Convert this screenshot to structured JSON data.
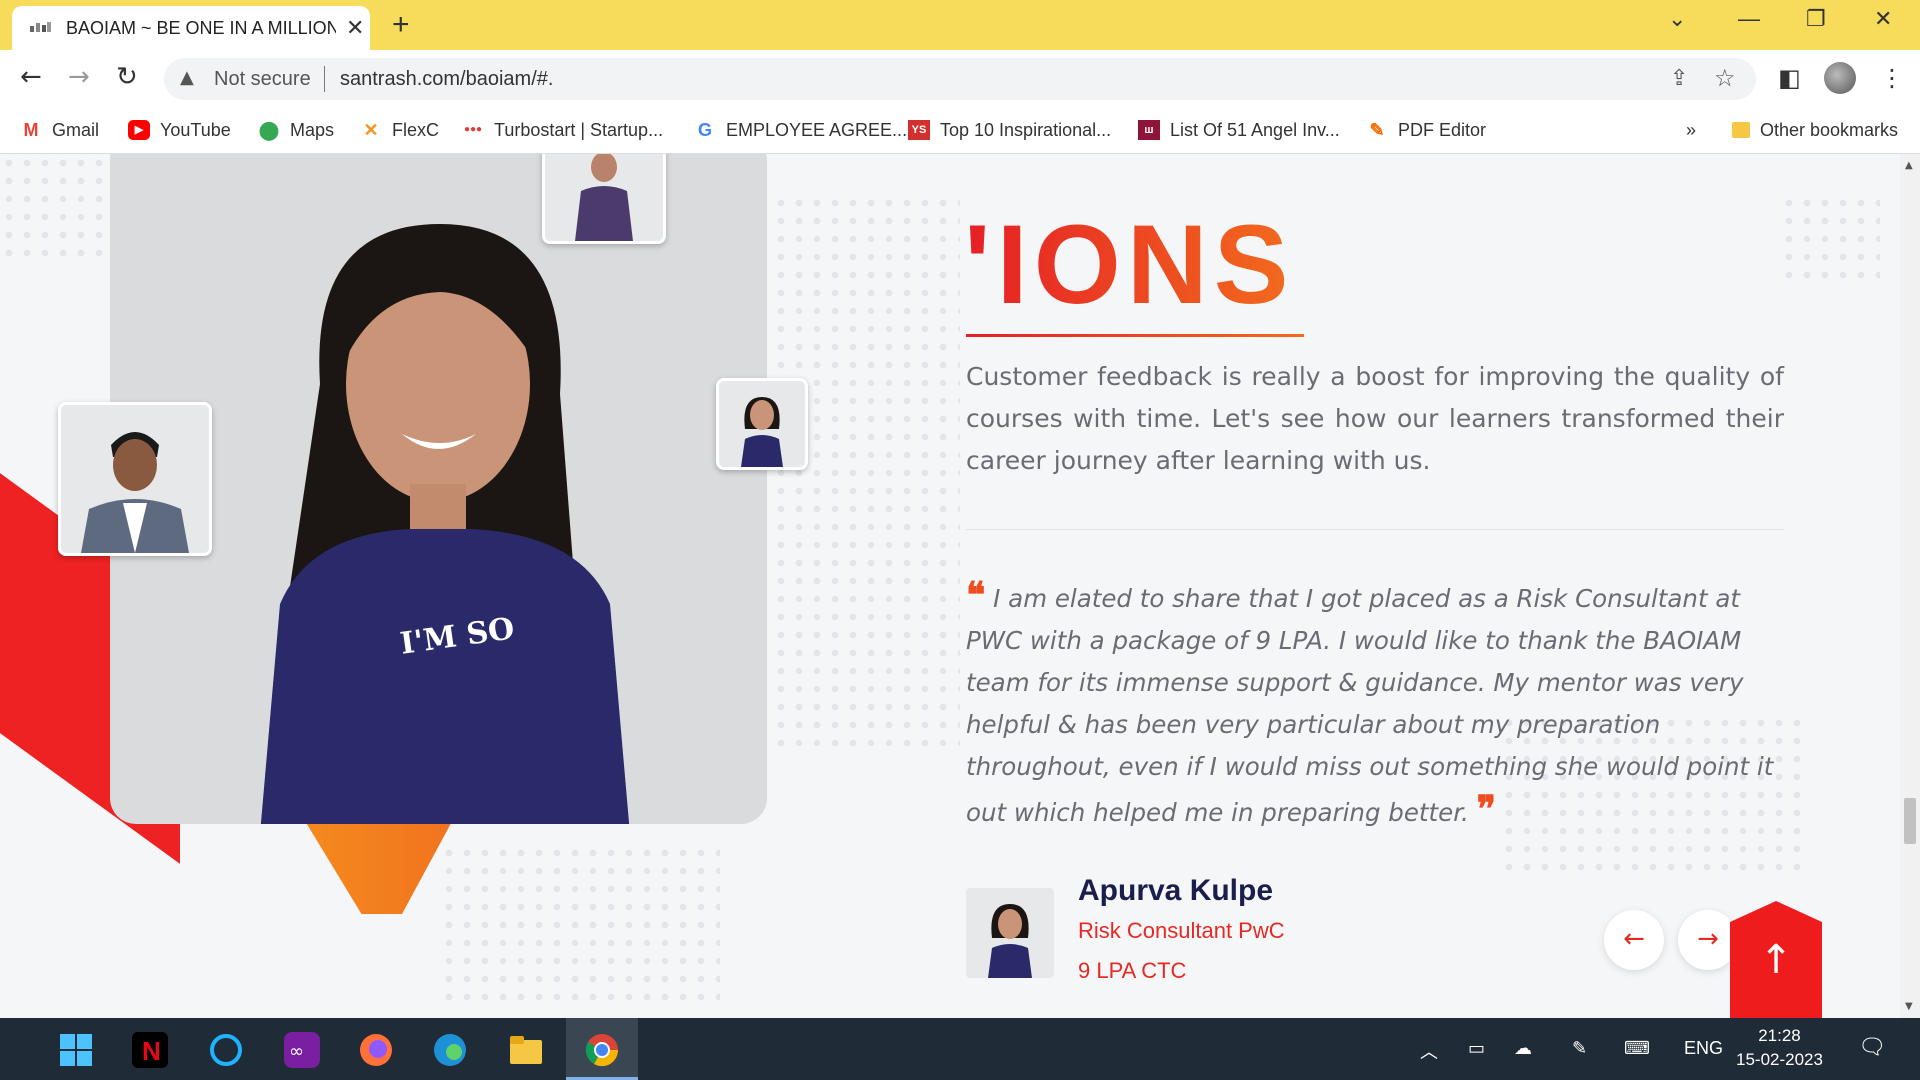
{
  "browser": {
    "tab_title": "BAOIAM ~ BE ONE IN A MILLION",
    "tab_close": "✕",
    "new_tab": "+",
    "security_label": "Not secure",
    "url": "santrash.com/baoiam/#."
  },
  "bookmarks": [
    {
      "label": "Gmail",
      "icon": "gmail-icon",
      "color": "#ea4335"
    },
    {
      "label": "YouTube",
      "icon": "youtube-icon",
      "color": "#ff0000"
    },
    {
      "label": "Maps",
      "icon": "maps-icon",
      "color": "#34a853"
    },
    {
      "label": "FlexC",
      "icon": "flexc-icon",
      "color": "#f7931e"
    },
    {
      "label": "Turbostart | Startup...",
      "icon": "turbostart-icon",
      "color": "#e53935"
    },
    {
      "label": "EMPLOYEE AGREE...",
      "icon": "google-icon",
      "color": "#4285f4"
    },
    {
      "label": "Top 10 Inspirational...",
      "icon": "ys-icon",
      "color": "#d32f2f"
    },
    {
      "label": "List Of 51 Angel Inv...",
      "icon": "angel-icon",
      "color": "#8e1538"
    },
    {
      "label": "PDF Editor",
      "icon": "pdf-editor-icon",
      "color": "#ff6d00"
    }
  ],
  "bookmarks_overflow": "»",
  "other_bookmarks": "Other bookmarks",
  "page": {
    "headline": "'IONS",
    "intro": "Customer feedback is really a boost for improving the quality of courses with time. Let's see how our learners transformed their career journey after learning with us.",
    "quote_open": "❝",
    "quote_close": "❞",
    "quote": "I am elated to share that I got placed as a Risk Consultant at PWC with a package of 9 LPA. I would like to thank the BAOIAM team for its immense support & guidance. My mentor was very helpful & has been very particular about my preparation throughout, even if I would miss out something she would point it out which helped me in preparing better.",
    "person_name": "Apurva Kulpe",
    "person_role": "Risk Consultant PwC",
    "person_ctc": "9 LPA CTC",
    "prev_arrow": "←",
    "next_arrow": "→",
    "to_top": "↑",
    "tshirt_text": "I'M SO"
  },
  "colors": {
    "accent_red": "#e52a24",
    "accent_orange": "#f26b1d",
    "tab_strip": "#f7dc5b",
    "taskbar": "#1f2b36"
  },
  "taskbar": {
    "language": "ENG",
    "time": "21:28",
    "date": "15-02-2023"
  }
}
